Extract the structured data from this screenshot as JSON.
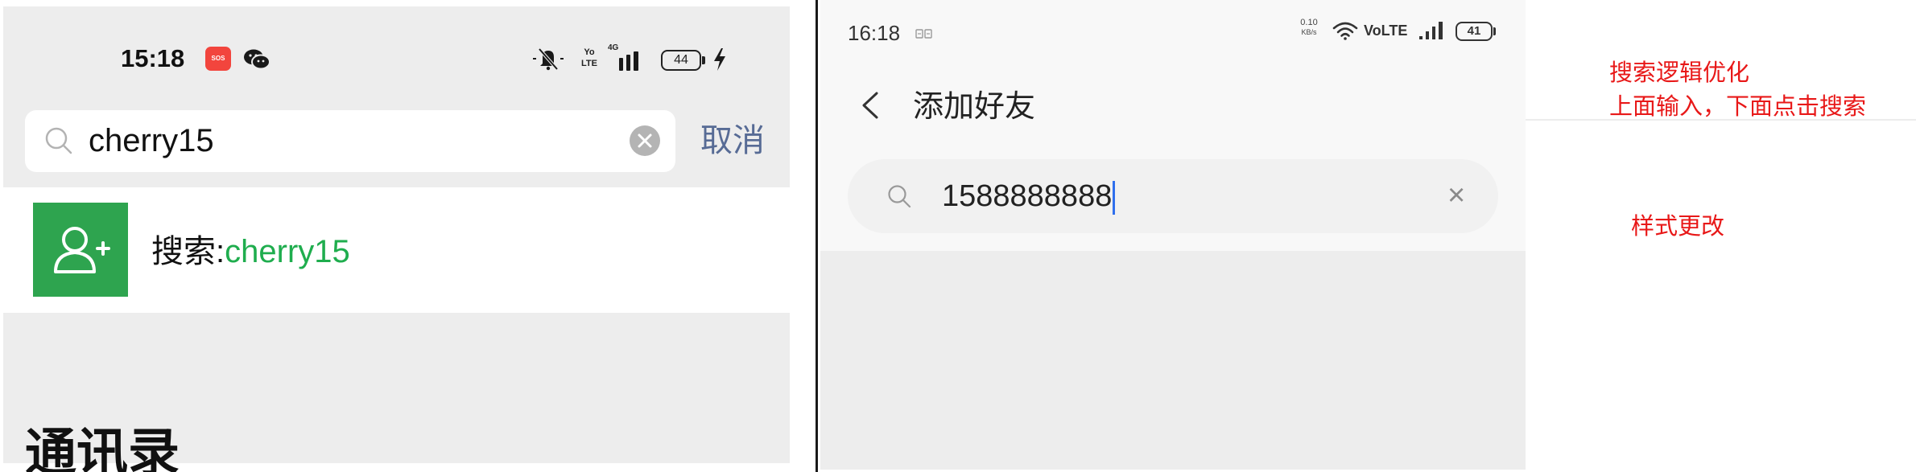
{
  "left_phone": {
    "status_bar": {
      "time": "15:18",
      "sos_label": "SOS",
      "volte_top": "Yo",
      "volte_bottom": "LTE",
      "network_type": "4G",
      "battery_level": "44"
    },
    "search": {
      "query": "cherry15",
      "cancel_label": "取消"
    },
    "result": {
      "prefix": "搜索:",
      "keyword": "cherry15"
    },
    "overlay_heading": "通讯录"
  },
  "right_phone": {
    "status_bar": {
      "time": "16:18",
      "speed_value": "0.10",
      "speed_unit": "KB/s",
      "volte_label": "VoLTE",
      "battery_level": "41"
    },
    "header": {
      "title": "添加好友"
    },
    "search": {
      "query": "1588888888",
      "clear_symbol": "×"
    }
  },
  "annotations": {
    "search_logic_title": "搜索逻辑优化",
    "search_logic_detail": "上面输入，下面点击搜索",
    "style_note": "样式更改"
  },
  "icons": {
    "left_status": [
      "sos-icon",
      "wechat-icon",
      "mute-bell-icon",
      "volte-icon",
      "signal-icon",
      "battery-icon",
      "charging-bolt-icon"
    ],
    "left_search": [
      "search-icon",
      "clear-icon"
    ],
    "left_result": "add-user-icon",
    "right_status": [
      "notification-icon",
      "wifi-icon",
      "signal-icon",
      "battery-icon"
    ],
    "right_header": "back-chevron-icon",
    "right_search": [
      "search-icon",
      "close-icon"
    ]
  },
  "colors": {
    "wechat_green_tile": "#2ea44f",
    "result_keyword_green": "#1fad4e",
    "cancel_link_blue": "#576b95",
    "caret_blue": "#2f6fed",
    "annotation_red": "#e81818",
    "sos_red": "#f2453d",
    "page_gray": "#ededed"
  }
}
